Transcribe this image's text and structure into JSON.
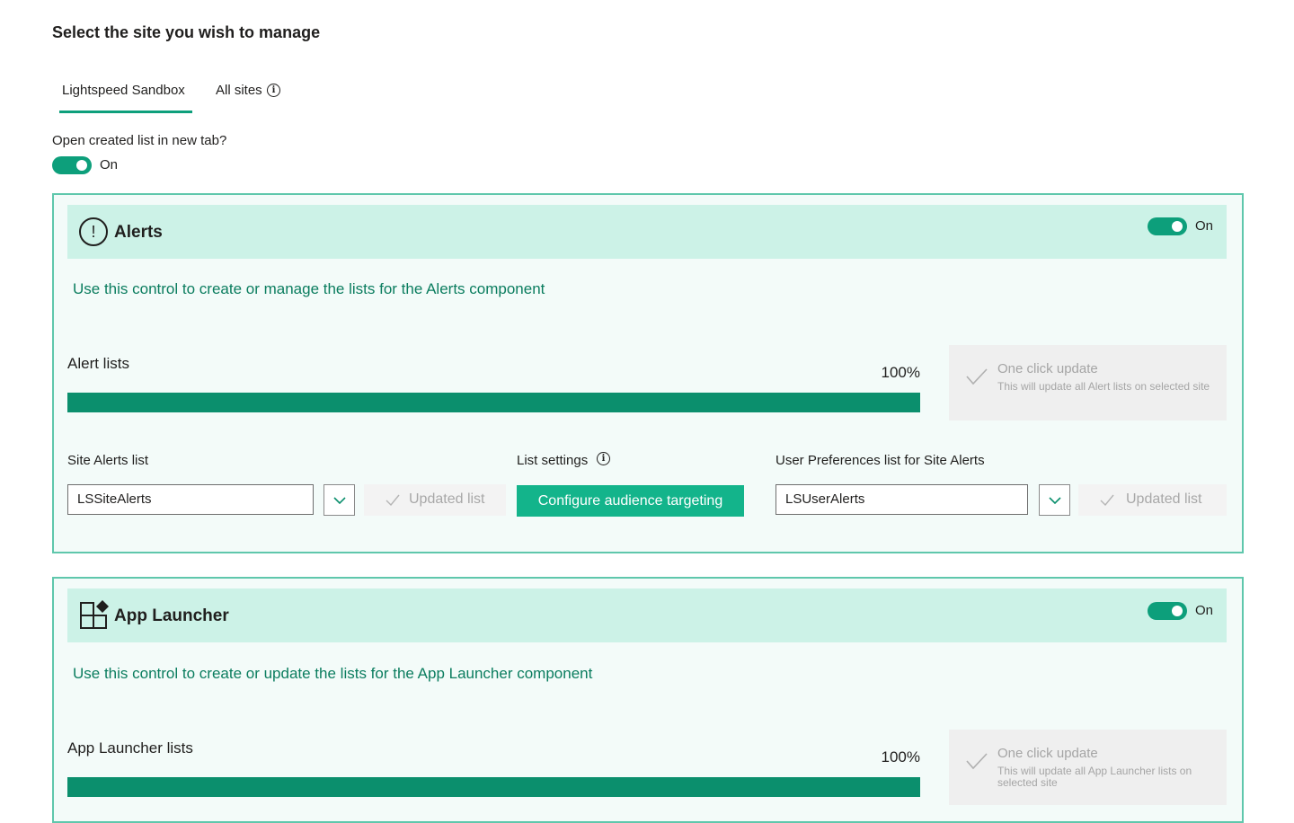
{
  "page": {
    "title": "Select the site you wish to manage"
  },
  "tabs": [
    {
      "label": "Lightspeed Sandbox",
      "selected": true
    },
    {
      "label": "All sites",
      "selected": false
    }
  ],
  "settings": {
    "open_new_tab_label": "Open created list in new tab?",
    "open_new_tab_state": "On"
  },
  "colors": {
    "accent": "#0d9f7b",
    "card_header_bg": "#ccf2e7",
    "description_text": "#0b7d5f",
    "primary_button": "#13b48b"
  },
  "alerts": {
    "title": "Alerts",
    "icon": "alert-circle-icon",
    "toggle_state": "On",
    "description": "Use this control to create or manage the lists for the Alerts component",
    "lists_heading": "Alert lists",
    "progress_percent_text": "100%",
    "progress_value": 1.0,
    "one_click": {
      "title": "One click update",
      "description": "This will update all Alert lists on selected site"
    },
    "site_list": {
      "label": "Site Alerts list",
      "value": "LSSiteAlerts",
      "updated_label": "Updated list"
    },
    "list_settings": {
      "label": "List settings",
      "button_label": "Configure audience targeting"
    },
    "user_prefs": {
      "label": "User Preferences list for Site Alerts",
      "value": "LSUserAlerts",
      "updated_label": "Updated list"
    }
  },
  "app_launcher": {
    "title": "App Launcher",
    "icon": "app-launcher-icon",
    "toggle_state": "On",
    "description": "Use this control to create or update the lists for the App Launcher component",
    "lists_heading": "App Launcher lists",
    "progress_percent_text": "100%",
    "progress_value": 1.0,
    "one_click": {
      "title": "One click update",
      "description": "This will update all App Launcher lists on selected site"
    }
  }
}
